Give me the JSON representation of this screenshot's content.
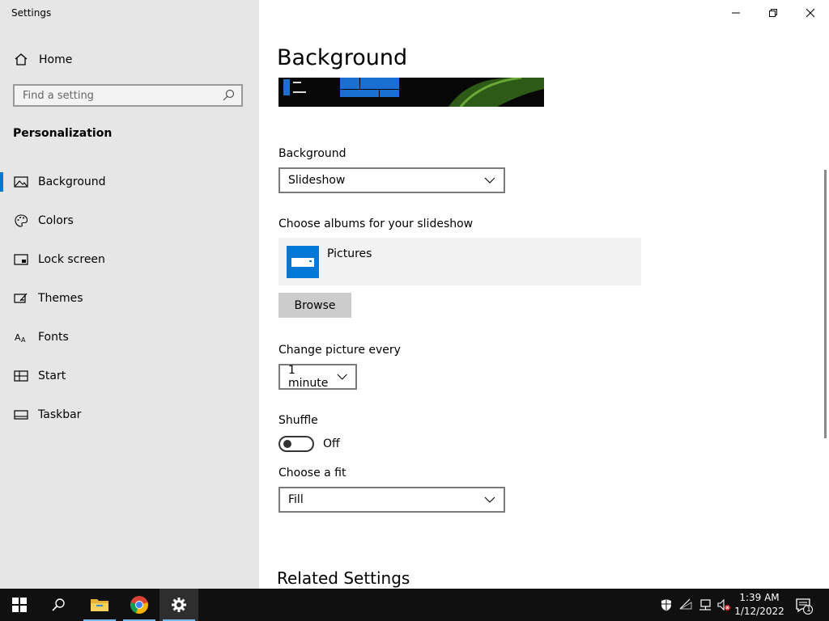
{
  "app": {
    "title": "Settings"
  },
  "sidebar": {
    "home_label": "Home",
    "search_placeholder": "Find a setting",
    "section_title": "Personalization",
    "items": [
      {
        "label": "Background",
        "icon": "picture-icon",
        "selected": true
      },
      {
        "label": "Colors",
        "icon": "palette-icon"
      },
      {
        "label": "Lock screen",
        "icon": "lock-screen-icon"
      },
      {
        "label": "Themes",
        "icon": "themes-icon"
      },
      {
        "label": "Fonts",
        "icon": "fonts-icon"
      },
      {
        "label": "Start",
        "icon": "start-icon"
      },
      {
        "label": "Taskbar",
        "icon": "taskbar-icon"
      }
    ]
  },
  "main": {
    "title": "Background",
    "background_label": "Background",
    "background_value": "Slideshow",
    "albums_label": "Choose albums for your slideshow",
    "album_name": "Pictures",
    "browse_label": "Browse",
    "change_label": "Change picture every",
    "change_value": "1 minute",
    "shuffle_label": "Shuffle",
    "shuffle_state": "Off",
    "fit_label": "Choose a fit",
    "fit_value": "Fill",
    "related_title": "Related Settings"
  },
  "taskbar": {
    "time": "1:39 AM",
    "date": "1/12/2022",
    "notification_count": "1",
    "apps": [
      "start-icon",
      "search-icon",
      "file-explorer-icon",
      "chrome-icon",
      "settings-icon"
    ]
  },
  "colors": {
    "accent": "#0078d7",
    "sidebar_bg": "#e6e6e6",
    "taskbar_bg": "#101010"
  }
}
